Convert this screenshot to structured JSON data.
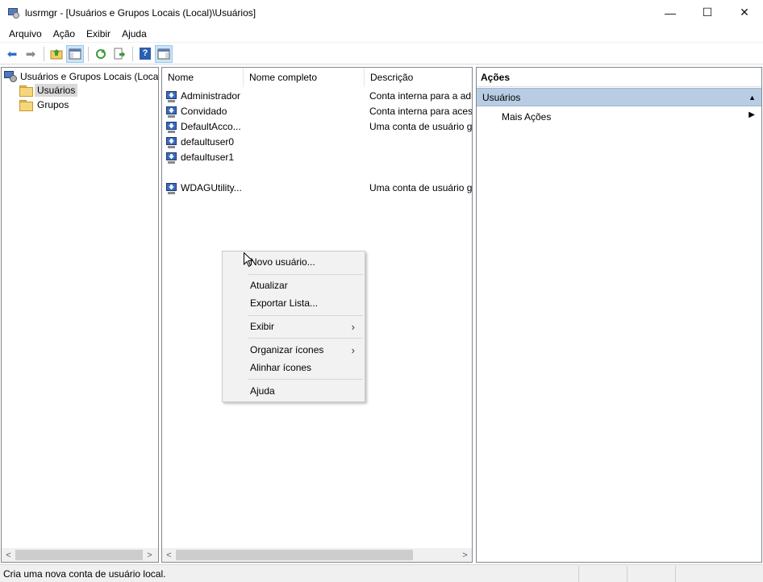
{
  "window": {
    "title": "lusrmgr - [Usuários e Grupos Locais (Local)\\Usuários]",
    "minimize_glyph": "—",
    "maximize_glyph": "☐",
    "close_glyph": "✕"
  },
  "menu": [
    "Arquivo",
    "Ação",
    "Exibir",
    "Ajuda"
  ],
  "toolbar": {
    "back_glyph": "⬅",
    "forward_glyph": "➡",
    "help_glyph": "?",
    "icons": [
      "back-icon",
      "forward-icon",
      "up-folder-icon",
      "show-hide-tree-icon",
      "refresh-icon",
      "export-list-icon",
      "help-icon",
      "show-hide-action-pane-icon"
    ]
  },
  "tree": {
    "root": "Usuários e Grupos Locais (Local)",
    "children": [
      "Usuários",
      "Grupos"
    ],
    "selected": "Usuários"
  },
  "list": {
    "columns": [
      "Nome",
      "Nome completo",
      "Descrição"
    ],
    "rows": [
      {
        "name": "Administrador",
        "full_name": "",
        "description": "Conta interna para a adr"
      },
      {
        "name": "Convidado",
        "full_name": "",
        "description": "Conta interna para acess"
      },
      {
        "name": "DefaultAcco...",
        "full_name": "",
        "description": "Uma conta de usuário g"
      },
      {
        "name": "defaultuser0",
        "full_name": "",
        "description": ""
      },
      {
        "name": "defaultuser1",
        "full_name": "",
        "description": ""
      },
      {
        "name": "WDAGUtility...",
        "full_name": "",
        "description": "Uma conta de usuário g"
      }
    ]
  },
  "context_menu": {
    "items": [
      {
        "label": "Novo usuário...",
        "submenu": false
      },
      {
        "label": "Atualizar",
        "submenu": false
      },
      {
        "label": "Exportar Lista...",
        "submenu": false
      },
      {
        "label": "Exibir",
        "submenu": true
      },
      {
        "label": "Organizar ícones",
        "submenu": true
      },
      {
        "label": "Alinhar ícones",
        "submenu": false
      },
      {
        "label": "Ajuda",
        "submenu": false
      }
    ],
    "submenu_glyph": "›"
  },
  "actions": {
    "header": "Ações",
    "section": "Usuários",
    "collapse_glyph": "▲",
    "links": [
      {
        "label": "Mais Ações",
        "glyph": "▶"
      }
    ]
  },
  "scroll": {
    "left_glyph": "<",
    "right_glyph": ">"
  },
  "status": {
    "text": "Cria uma nova conta de usuário local."
  },
  "colors": {
    "selection": "#d9d9d9",
    "actions_section_bg": "#b8cde3"
  }
}
